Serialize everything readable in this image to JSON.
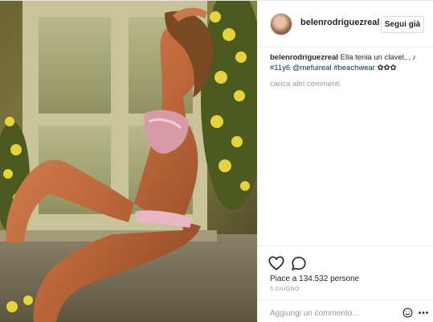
{
  "header": {
    "username": "belenrodriguezreal",
    "follow_label": "Segui già"
  },
  "caption": {
    "user": "belenrodriguezreal",
    "text": " Ella tenia un clavel... ♪",
    "tags": [
      "#11y6",
      "@mefuireal",
      "#beachwear"
    ],
    "flowers": " ✿✿✿"
  },
  "comments": {
    "load_more": "carica altri commenti"
  },
  "actions": {
    "like_icon": "heart-icon",
    "comment_icon": "comment-icon",
    "likes_prefix": "Piace a ",
    "likes_count": "134.532",
    "likes_suffix": " persone",
    "date": "5 giugno"
  },
  "add_comment": {
    "placeholder": "Aggiungi un commento...",
    "emoji_icon": "emoji-icon",
    "more_icon": "more-icon"
  },
  "photo": {
    "alt_subject": "woman-in-bikini-by-window-with-yellow-flowers"
  }
}
